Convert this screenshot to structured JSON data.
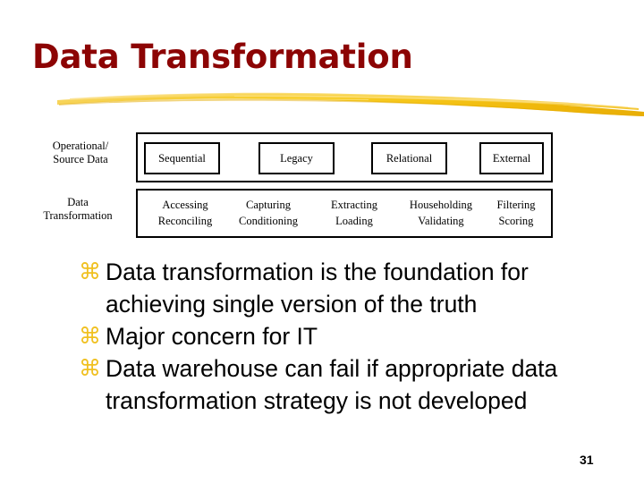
{
  "slide": {
    "title": "Data Transformation",
    "page_number": "31",
    "title_color": "#8C0404",
    "bullet_color": "#F0C020",
    "background_color": "#FFFFFF",
    "accent_brush_color": "#F5C518"
  },
  "diagram": {
    "rows": [
      {
        "label_line1": "Operational/",
        "label_line2": "Source Data",
        "cells": [
          {
            "text": "Sequential"
          },
          {
            "text": "Legacy"
          },
          {
            "text": "Relational"
          },
          {
            "text": "External"
          }
        ]
      },
      {
        "label_line1": "Data",
        "label_line2": "Transformation",
        "cells": [
          {
            "line1": "Accessing",
            "line2": "Reconciling"
          },
          {
            "line1": "Capturing",
            "line2": "Conditioning"
          },
          {
            "line1": "Extracting",
            "line2": "Loading"
          },
          {
            "line1": "Householding",
            "line2": "Validating"
          },
          {
            "line1": "Filtering",
            "line2": "Scoring"
          }
        ]
      }
    ]
  },
  "bullets": {
    "marker_glyph": "⌘",
    "items": [
      {
        "text": "Data transformation is the foundation for achieving single version of the truth"
      },
      {
        "text": "Major concern for IT"
      },
      {
        "text": "Data warehouse can fail if appropriate data  transformation strategy is not developed"
      }
    ]
  }
}
